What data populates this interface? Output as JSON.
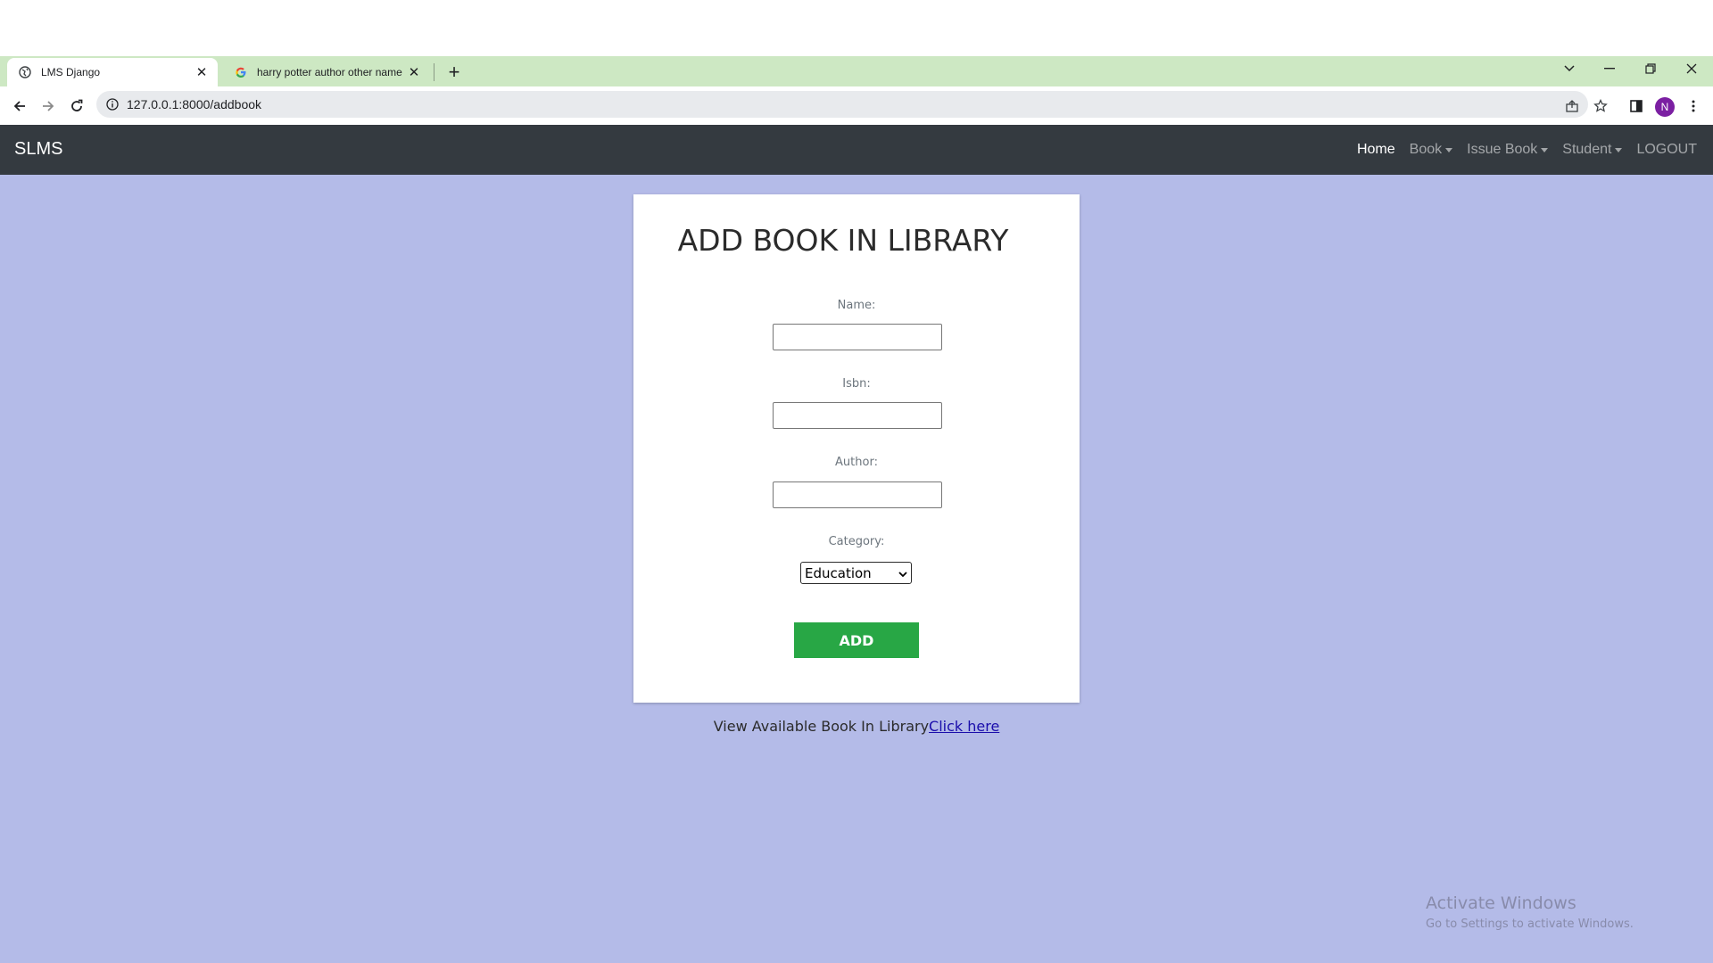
{
  "browser": {
    "tabs": [
      {
        "title": "LMS Django",
        "active": true
      },
      {
        "title": "harry potter author other name",
        "active": false
      }
    ],
    "url": "127.0.0.1:8000/addbook",
    "profile_initial": "N",
    "tabstrip_color": "#cde8c3"
  },
  "navbar": {
    "brand": "SLMS",
    "links": [
      {
        "label": "Home",
        "active": true,
        "dropdown": false
      },
      {
        "label": "Book",
        "active": false,
        "dropdown": true
      },
      {
        "label": "Issue Book",
        "active": false,
        "dropdown": true
      },
      {
        "label": "Student",
        "active": false,
        "dropdown": true
      },
      {
        "label": "LOGOUT",
        "active": false,
        "dropdown": false
      }
    ]
  },
  "form": {
    "title": "ADD BOOK IN LIBRARY",
    "fields": [
      {
        "label": "Name:",
        "value": ""
      },
      {
        "label": "Isbn:",
        "value": ""
      },
      {
        "label": "Author:",
        "value": ""
      }
    ],
    "category": {
      "label": "Category:",
      "selected": "Education"
    },
    "submit_label": "ADD"
  },
  "footer": {
    "text": "View Available Book In Library",
    "link_text": "Click here"
  },
  "watermark": {
    "title": "Activate Windows",
    "subtitle": "Go to Settings to activate Windows."
  },
  "colors": {
    "page_background": "#b4bbe8",
    "navbar": "#343a40",
    "add_button": "#28a745"
  }
}
